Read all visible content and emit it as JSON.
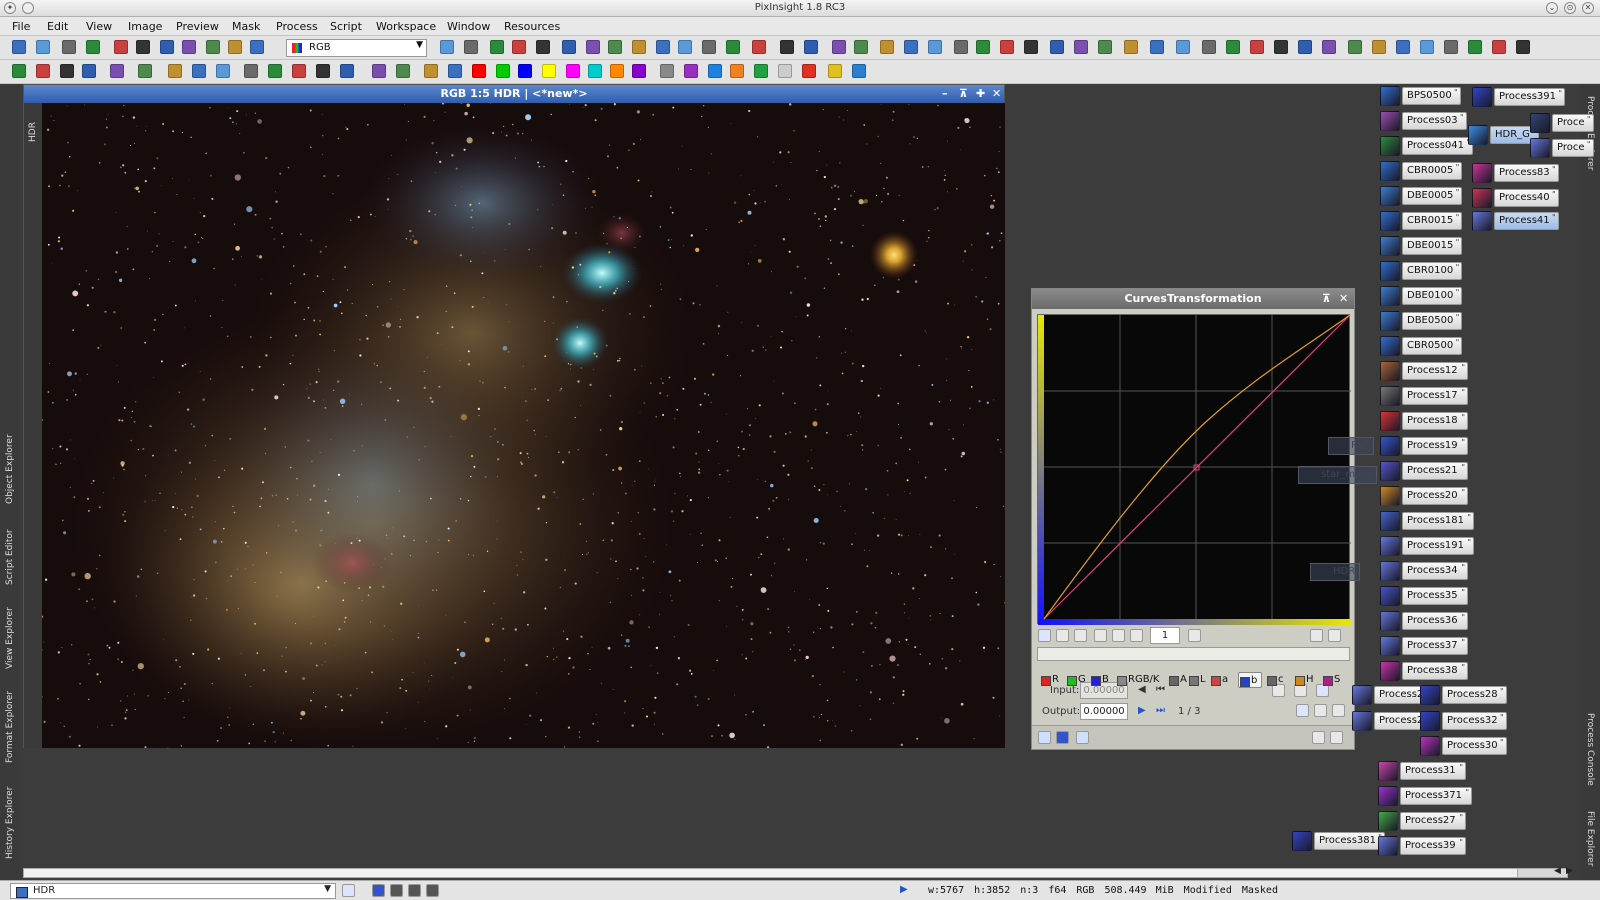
{
  "app": {
    "title": "PixInsight 1.8 RC3"
  },
  "menu": [
    "File",
    "Edit",
    "View",
    "Image",
    "Preview",
    "Mask",
    "Process",
    "Script",
    "Workspace",
    "Window",
    "Resources"
  ],
  "toolbar": {
    "rgb_select": "RGB",
    "channel_colors": [
      "#ff0000",
      "#00cc00",
      "#0000ff",
      "#ffff00",
      "#ff00ff",
      "#00cccc",
      "#ff8800",
      "#8800cc"
    ]
  },
  "left_dock": [
    "Object Explorer",
    "Script Editor",
    "View Explorer",
    "Format Explorer",
    "History Explorer"
  ],
  "right_dock": [
    "Process Explorer",
    "Process Console",
    "File Explorer"
  ],
  "image_window": {
    "title": "RGB 1:5 HDR | <*new*>",
    "side_label": "HDR"
  },
  "curves": {
    "title": "CurvesTransformation",
    "zoom": "1",
    "channels": [
      {
        "label": "R",
        "color": "#dd2222"
      },
      {
        "label": "G",
        "color": "#22bb22"
      },
      {
        "label": "B",
        "color": "#2222dd"
      },
      {
        "label": "RGB/K",
        "color": "#888888"
      },
      {
        "label": "A",
        "color": "#666666"
      },
      {
        "label": "L",
        "color": "#777777"
      },
      {
        "label": "a",
        "color": "#cc4444"
      },
      {
        "label": "b",
        "color": "#2244cc"
      },
      {
        "label": "c",
        "color": "#666666"
      },
      {
        "label": "H",
        "color": "#cc8822"
      },
      {
        "label": "S",
        "color": "#aa2288"
      }
    ],
    "active_channel": "b",
    "input_label": "Input:",
    "input_value": "0.00000",
    "output_label": "Output:",
    "output_value": "0.00000",
    "point_index": "1 / 3"
  },
  "process_icons": [
    {
      "label": "BPS0500",
      "color": "#2f6fd0"
    },
    {
      "label": "Process03",
      "color": "#9a4fb0"
    },
    {
      "label": "Process041",
      "color": "#2b8b3a"
    },
    {
      "label": "CBR0005",
      "color": "#2f6fd0"
    },
    {
      "label": "DBE0005",
      "color": "#3a7ed0"
    },
    {
      "label": "CBR0015",
      "color": "#2f6fd0"
    },
    {
      "label": "DBE0015",
      "color": "#3a7ed0"
    },
    {
      "label": "CBR0100",
      "color": "#2f6fd0"
    },
    {
      "label": "DBE0100",
      "color": "#3a7ed0"
    },
    {
      "label": "DBE0500",
      "color": "#3a7ed0"
    },
    {
      "label": "CBR0500",
      "color": "#2f6fd0"
    },
    {
      "label": "Process12",
      "color": "#aa6633"
    },
    {
      "label": "Process17",
      "color": "#777777"
    },
    {
      "label": "Process18",
      "color": "#dd3333"
    },
    {
      "label": "Process19",
      "color": "#3355cc"
    },
    {
      "label": "Process21",
      "color": "#5555cc"
    },
    {
      "label": "Process20",
      "color": "#cc8822"
    },
    {
      "label": "Process181",
      "color": "#4466cc"
    },
    {
      "label": "Process191",
      "color": "#6677dd"
    },
    {
      "label": "Process34",
      "color": "#6677dd"
    },
    {
      "label": "Process35",
      "color": "#4455cc"
    },
    {
      "label": "Process36",
      "color": "#6677dd"
    },
    {
      "label": "Process37",
      "color": "#6677dd"
    },
    {
      "label": "Process38",
      "color": "#cc33aa"
    },
    {
      "label": "Process25",
      "color": "#6677dd"
    },
    {
      "label": "Process26",
      "color": "#6677dd"
    },
    {
      "label": "Process28",
      "color": "#3344cc"
    },
    {
      "label": "Process32",
      "color": "#3344cc"
    },
    {
      "label": "Process30",
      "color": "#bb33bb"
    },
    {
      "label": "Process31",
      "color": "#cc44aa"
    },
    {
      "label": "Process371",
      "color": "#9933cc"
    },
    {
      "label": "Process27",
      "color": "#44aa44"
    },
    {
      "label": "Process381",
      "color": "#3344cc"
    },
    {
      "label": "Process39",
      "color": "#6677dd"
    },
    {
      "label": "Process391",
      "color": "#3344cc"
    },
    {
      "label": "HDR_G",
      "color": "#3b8ee6"
    },
    {
      "label": "Proce",
      "color": "#334477"
    },
    {
      "label": "Proce",
      "color": "#6677dd"
    },
    {
      "label": "Process83",
      "color": "#cc3399"
    },
    {
      "label": "Process40",
      "color": "#cc3355"
    },
    {
      "label": "Process41",
      "color": "#6677dd"
    }
  ],
  "ghost_icons": [
    "PSF",
    "star_mask",
    "HDR"
  ],
  "statusbar": {
    "view": "HDR",
    "width": "w:5767",
    "height": "h:3852",
    "channels": "n:3",
    "bits": "f64",
    "space": "RGB",
    "size": "508.449 MiB",
    "state1": "Modified",
    "state2": "Masked"
  }
}
